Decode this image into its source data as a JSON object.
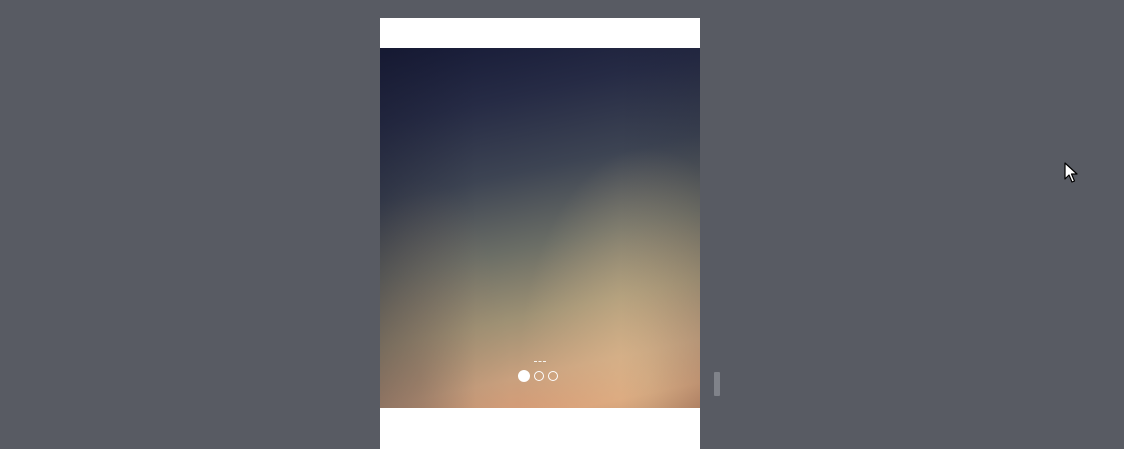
{
  "carousel": {
    "slide_count": 3,
    "active_index": 0,
    "indicators": [
      {
        "state": "active"
      },
      {
        "state": "inactive"
      },
      {
        "state": "inactive"
      }
    ]
  },
  "colors": {
    "backdrop": "#585b63",
    "device_bg": "#ffffff",
    "indicator": "#ffffff"
  },
  "icons": {
    "cursor": "arrow-cursor-icon"
  }
}
